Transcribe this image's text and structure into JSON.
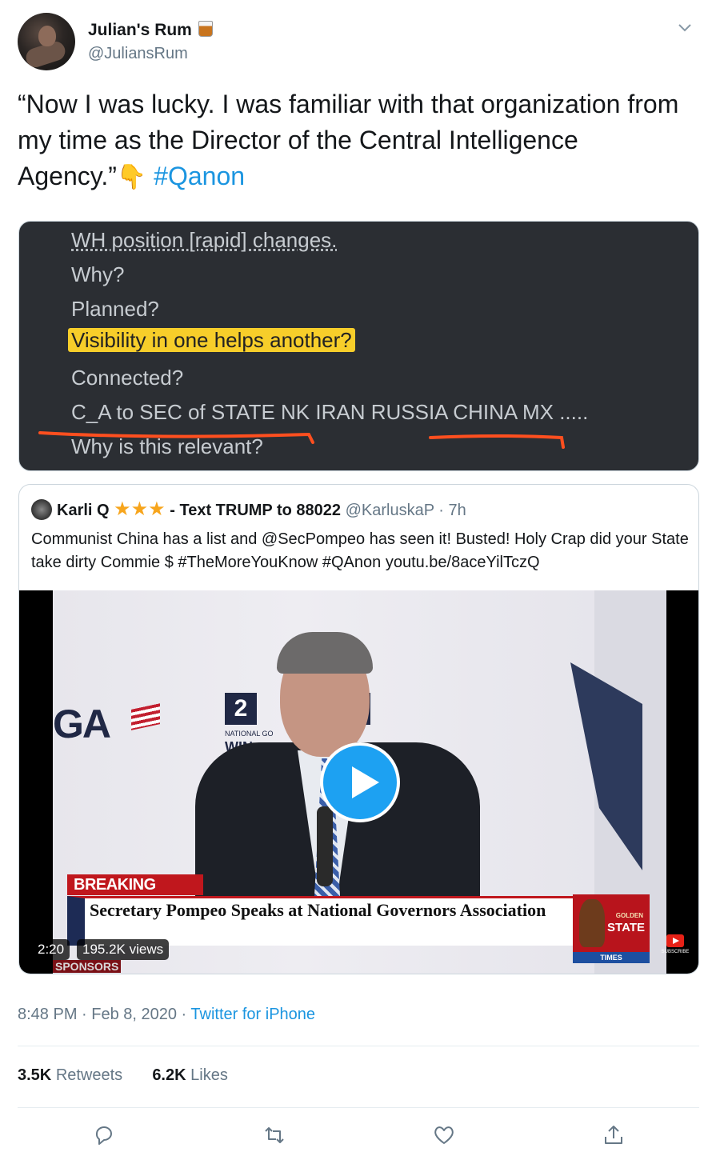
{
  "author": {
    "name": "Julian's Rum",
    "handle": "@JuliansRum",
    "name_emoji_icon": "tumbler-glass-icon"
  },
  "tweet": {
    "text_quote": "“Now I was lucky. I was familiar with that organization from my time as the Director of the Central Intelligence Agency.”",
    "emoji": "👇",
    "hashtag": "#Qanon"
  },
  "image_post": {
    "lines": [
      "WH position [rapid] changes.",
      "Why?",
      "Planned?",
      "Visibility in one helps another?",
      "Connected?",
      "C_A to SEC of STATE NK IRAN RUSSIA CHINA MX .....",
      "Why is this relevant?"
    ],
    "highlight_color": "#f7ce2a",
    "annotation_color": "#ff4f1f"
  },
  "quoted_tweet": {
    "name": "Karli Q",
    "stars": "★★★",
    "name_suffix": "- Text TRUMP to 88022",
    "handle": "@KarluskaP",
    "time": "· 7h",
    "text": "Communist China has a list and @SecPompeo has seen it! Busted! Holy Crap did your State take dirty Commie $ #TheMoreYouKnow #QAnon youtu.be/8aceYilTczQ",
    "video": {
      "breaking_label": "BREAKING NEWS",
      "headline": "Secretary Pompeo Speaks at National Governors Association",
      "sign_number": "2",
      "sign_sub": "NATIONAL GO",
      "sign_win": "WIN",
      "ga_logo": "GA",
      "station_top": "GOLDEN",
      "station_name": "STATE",
      "station_bar": "TIMES",
      "subscribe": "SUBSCRIBE",
      "sponsors": "SPONSORS",
      "duration": "2:20",
      "views": "195.2K views"
    }
  },
  "meta": {
    "time": "8:48 PM · Feb 8, 2020 · ",
    "source": "Twitter for iPhone"
  },
  "stats": {
    "retweets_count": "3.5K",
    "retweets_label": "Retweets",
    "likes_count": "6.2K",
    "likes_label": "Likes"
  },
  "colors": {
    "accent": "#1b95e0",
    "play_button": "#1da1f2",
    "secondary_text": "#657786"
  }
}
